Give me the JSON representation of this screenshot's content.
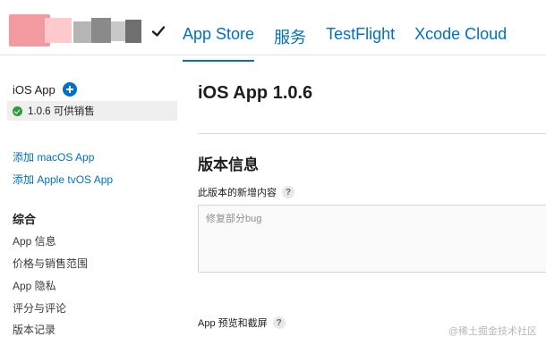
{
  "header": {
    "tabs": [
      {
        "label": "App Store"
      },
      {
        "label": "服务"
      },
      {
        "label": "TestFlight"
      },
      {
        "label": "Xcode Cloud"
      }
    ]
  },
  "sidebar": {
    "app_title": "iOS App",
    "version_label": "1.0.6 可供销售",
    "add_mac": "添加 macOS App",
    "add_tv": "添加 Apple tvOS App",
    "section": "综合",
    "items": [
      {
        "label": "App 信息"
      },
      {
        "label": "价格与销售范围"
      },
      {
        "label": "App 隐私"
      },
      {
        "label": "评分与评论"
      },
      {
        "label": "版本记录"
      }
    ]
  },
  "main": {
    "page_title": "iOS App 1.0.6",
    "section_title": "版本信息",
    "whats_new_label": "此版本的新增内容",
    "whats_new_value": "修复部分bug",
    "preview_label": "App 预览和截屏",
    "help_glyph": "?"
  },
  "watermark": "@稀土掘金技术社区",
  "colors": {
    "accent": "#0070c9",
    "status_ok": "#2a9d3a"
  }
}
